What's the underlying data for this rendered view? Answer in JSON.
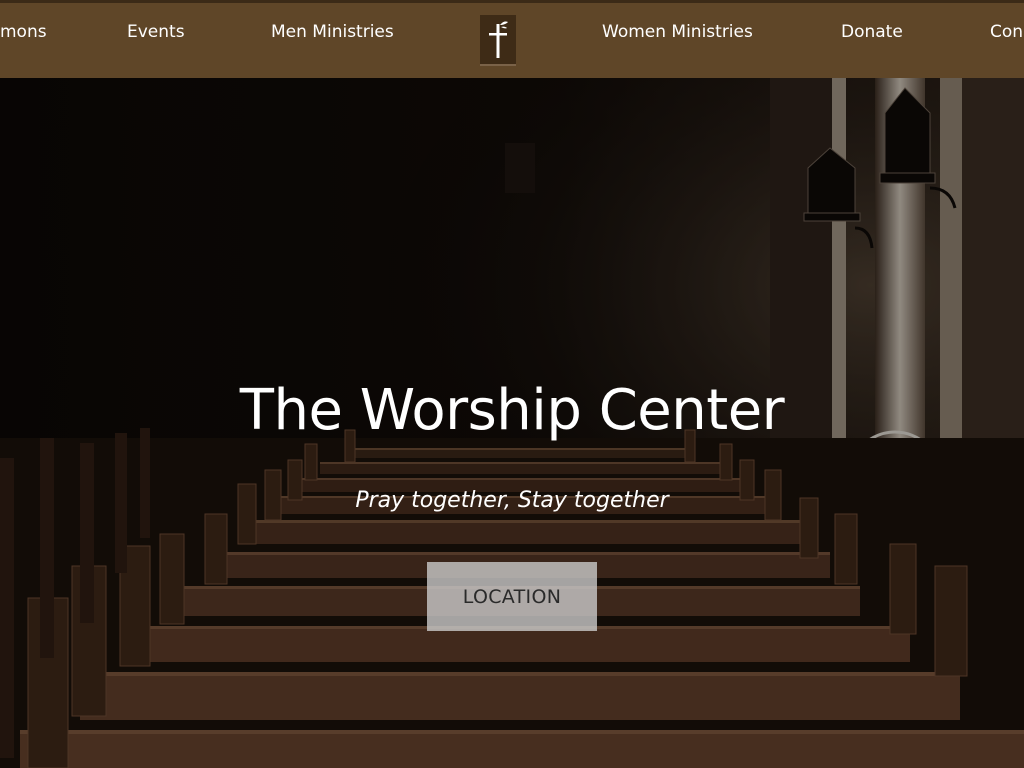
{
  "nav": {
    "items": [
      {
        "label": "mons"
      },
      {
        "label": "Events"
      },
      {
        "label": "Men Ministries"
      },
      {
        "label": "Women Ministries"
      },
      {
        "label": "Donate"
      },
      {
        "label": "Con"
      }
    ],
    "logo_icon": "cross-icon"
  },
  "hero": {
    "title": "The Worship Center",
    "tagline": "Pray together, Stay together",
    "button_label": "LOCATION"
  },
  "colors": {
    "nav_background": "#5f4628",
    "button_background": "#cecece",
    "text": "#ffffff"
  }
}
